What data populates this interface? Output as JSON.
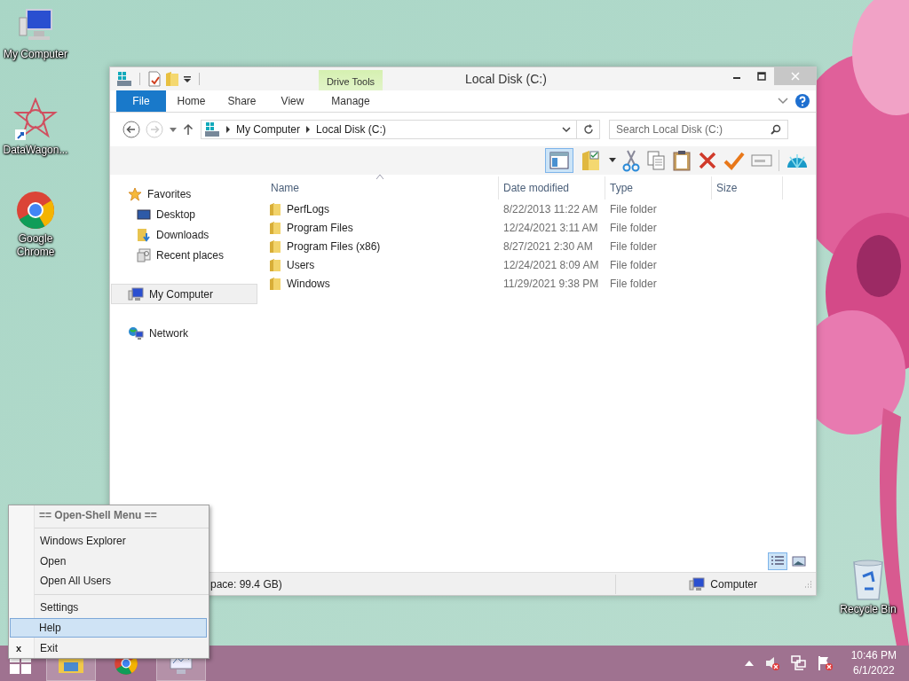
{
  "desktop_icons": [
    {
      "label": "My Computer",
      "kind": "computer"
    },
    {
      "label": "DataWagon...",
      "kind": "star"
    },
    {
      "label": "Google Chrome",
      "kind": "chrome"
    },
    {
      "label": "Recycle Bin",
      "kind": "bin"
    }
  ],
  "window": {
    "title": "Local Disk (C:)",
    "context_group": "Drive Tools",
    "ribbon_tabs": [
      {
        "label": "File",
        "kind": "file"
      },
      {
        "label": "Home",
        "kind": "tab"
      },
      {
        "label": "Share",
        "kind": "tab"
      },
      {
        "label": "View",
        "kind": "tab"
      },
      {
        "label": "Manage",
        "kind": "context"
      }
    ],
    "address": {
      "crumbs": [
        "My Computer",
        "Local Disk (C:)"
      ]
    },
    "search": {
      "placeholder": "Search Local Disk (C:)"
    },
    "toolbar": {
      "preview_pane_on": true
    },
    "nav": [
      {
        "label": "Favorites",
        "kind": "star",
        "selected": false,
        "children": [
          {
            "label": "Desktop",
            "kind": "desktop",
            "selected": false
          },
          {
            "label": "Downloads",
            "kind": "downloads",
            "selected": false
          },
          {
            "label": "Recent places",
            "kind": "recent",
            "selected": false
          }
        ]
      },
      {
        "label": "My Computer",
        "kind": "computer",
        "selected": true
      },
      {
        "label": "Network",
        "kind": "network",
        "selected": false
      }
    ],
    "columns": [
      "Name",
      "Date modified",
      "Type",
      "Size"
    ],
    "rows": [
      {
        "name": "PerfLogs",
        "date": "8/22/2013 11:22 AM",
        "type": "File folder"
      },
      {
        "name": "Program Files",
        "date": "12/24/2021 3:11 AM",
        "type": "File folder"
      },
      {
        "name": "Program Files (x86)",
        "date": "8/27/2021 2:30 AM",
        "type": "File folder"
      },
      {
        "name": "Users",
        "date": "12/24/2021 8:09 AM",
        "type": "File folder"
      },
      {
        "name": "Windows",
        "date": "11/29/2021 9:38 PM",
        "type": "File folder"
      }
    ],
    "views": [
      {
        "kind": "details",
        "selected": true
      },
      {
        "kind": "thumbnails",
        "selected": false
      }
    ],
    "status_bar": {
      "text": "pace: 99.4 GB)",
      "location": "Computer"
    }
  },
  "menu": {
    "title": "== Open-Shell Menu ==",
    "groups": [
      [
        {
          "label": "Windows Explorer",
          "selected": false
        },
        {
          "label": "Open",
          "selected": false
        },
        {
          "label": "Open All Users",
          "selected": false
        }
      ],
      [
        {
          "label": "Settings",
          "selected": false
        },
        {
          "label": "Help",
          "selected": true
        },
        {
          "label": "Exit",
          "selected": false,
          "mark": "x"
        }
      ]
    ]
  },
  "taskbar": {
    "apps": [
      {
        "kind": "explorer",
        "active": true
      },
      {
        "kind": "chrome",
        "active": false
      },
      {
        "kind": "monitor",
        "active": true
      }
    ],
    "time": "10:46 PM",
    "date": "6/1/2022"
  }
}
